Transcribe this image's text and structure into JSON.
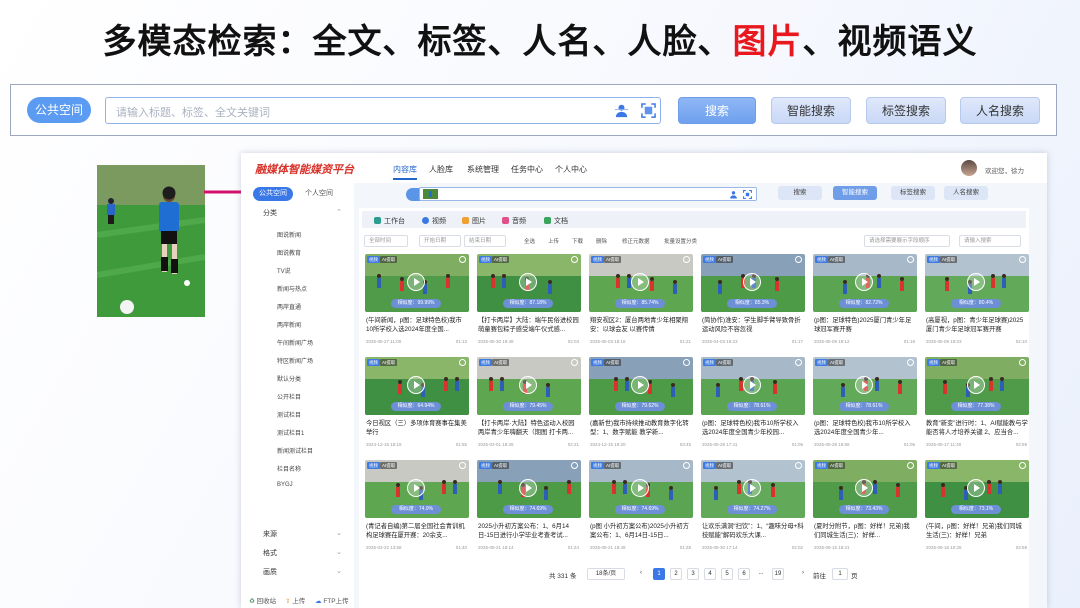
{
  "title": {
    "part1": "多模态检索：全文、标签、人名、人脸、",
    "highlight": "图片",
    "part2": "、视频语义"
  },
  "colors": {
    "accent": "#5b9cf2",
    "highlight": "#e8181e",
    "brand": "#d9322b"
  },
  "big_search": {
    "scope_label": "公共空间",
    "placeholder": "请输入标题、标签、全文关键词",
    "icons": [
      "face-search-icon",
      "image-search-icon"
    ],
    "buttons": [
      "搜索",
      "智能搜索",
      "标签搜索",
      "人名搜索"
    ]
  },
  "app": {
    "brand": "融媒体智能媒资平台",
    "nav": [
      "内容库",
      "人脸库",
      "系统管理",
      "任务中心",
      "个人中心"
    ],
    "user": "欢迎您，徐力",
    "sidebar_tabs": [
      "公共空间",
      "个人空间"
    ],
    "sidebar_sections": [
      {
        "label": "分类",
        "items": [
          "图说新闻",
          "图说教育",
          "TV说",
          "新闻与热点",
          "两岸直通",
          "两岸新闻",
          "午间新闻广场",
          "特区新闻广场",
          "默认分类",
          "公开栏目",
          "测试栏目",
          "测试栏目1",
          "新闻测试栏目",
          "栏目名称",
          "BYGJ"
        ]
      },
      {
        "label": "来源",
        "items": []
      },
      {
        "label": "格式",
        "items": []
      },
      {
        "label": "画质",
        "items": []
      }
    ],
    "sidebar_footer": [
      "回收站",
      "上传",
      "FTP上传"
    ],
    "search_buttons": [
      "搜索",
      "智能搜索",
      "标签搜索",
      "人名搜索"
    ],
    "media_tabs": [
      "工作台",
      "视频",
      "图片",
      "音频",
      "文档"
    ],
    "filters": {
      "time": "全部时间",
      "start": "开始日期",
      "end": "结束日期",
      "select_all": "全选",
      "actions": [
        "上传",
        "下载",
        "删除",
        "修正元数据",
        "批量设置分类"
      ],
      "select_placeholder": "请选择需要展示字段顺序",
      "search_placeholder": "请输入搜索"
    },
    "cards": [
      {
        "title": "(午间新闻，p图：足球特色校)我市10所学校入选2024年度全国...",
        "date": "2025-05-27 11:00",
        "dur": "01:13",
        "sim": "相似度：99.99%",
        "tags": [
          "视频",
          "AI提取"
        ]
      },
      {
        "title": "【打卡两岸】大陆：端午民俗进校园 萌童赛包粽子感受端午仪式感...",
        "date": "2025-05-30 19:48",
        "dur": "02:03",
        "sim": "相似度：87.18%",
        "tags": [
          "视频",
          "AI提取"
        ]
      },
      {
        "title": "翔安视区2：厦台两地青少年相聚翔安：以球会友 以赛传情",
        "date": "2025-05-03 18:16",
        "dur": "01:21",
        "sim": "相似度：85.74%",
        "tags": [
          "视频",
          "AI提取"
        ]
      },
      {
        "title": "(简协作)淮安：学生脚手臂导致骨折 运动风险不容忽视",
        "date": "2025-04-03 19:23",
        "dur": "01:17",
        "sim": "相似度：85.3%",
        "tags": [
          "视频",
          "AI提取"
        ]
      },
      {
        "title": "(p图：足球特色)2025厦门青少年足球冠军赛开赛",
        "date": "2025-05-09 18:12",
        "dur": "01:18",
        "sim": "相似度：82.72%",
        "tags": [
          "视频",
          "AI提取"
        ]
      },
      {
        "title": "(高厦视，p图：青少年足球赛)2025厦门青少年足球冠军赛开赛",
        "date": "2025-05-09 18:03",
        "dur": "02:10",
        "sim": "相似度：80.4%",
        "tags": [
          "视频",
          "AI提取"
        ]
      },
      {
        "title": "今日视区（三）多项体育赛事在集美举行",
        "date": "2024-12-16 18:18",
        "dur": "01:55",
        "sim": "相似度：64.94%",
        "tags": [
          "视频",
          "AI提取"
        ]
      },
      {
        "title": "【打卡两岸·大陆】特色运动入校园 两岸青少年嗨翻天（期图 打卡两...",
        "date": "2025-03-01 18:26",
        "dur": "02:21",
        "sim": "相似度：79.45%",
        "tags": [
          "视频",
          "AI提取"
        ]
      },
      {
        "title": "(嘉新世)我市持续推动教育数字化转型：1、数字赋能 教学新...",
        "date": "2024-12-15 19:20",
        "dur": "03:45",
        "sim": "相似度：79.62%",
        "tags": [
          "视频",
          "AI提取"
        ]
      },
      {
        "title": "(p图：足球特色校)我市10所学校入选2024年度全国青少年校园...",
        "date": "2025-05-28 17:41",
        "dur": "01:05",
        "sim": "相似度：78.61%",
        "tags": [
          "视频",
          "AI提取"
        ]
      },
      {
        "title": "(p图：足球特色校)我市10所学校入选2024年度全国青少年...",
        "date": "2025-05-28 18:58",
        "dur": "01:05",
        "sim": "相似度：78.61%",
        "tags": [
          "视频",
          "AI提取"
        ]
      },
      {
        "title": "教育“新变”进行时：1、AI赋能教与学 能否将人才培养关键 2、应当合...",
        "date": "2025-05-17 11:40",
        "dur": "02:59",
        "sim": "相似度：77.38%",
        "tags": [
          "视频",
          "AI提取"
        ]
      },
      {
        "title": "(青记者自编)第二届全国社会青训机构足球赛在厦开赛：20余支...",
        "date": "2025-03-22 13:58",
        "dur": "01:40",
        "sim": "相似度：74.9%",
        "tags": [
          "视频",
          "AI提取"
        ]
      },
      {
        "title": "2025小升初方案公布：1、6月14日-15日进行小学毕业考查考试...",
        "date": "2025-05-21 18:14",
        "dur": "01:24",
        "sim": "相似度：74.69%",
        "tags": [
          "视频",
          "AI提取"
        ]
      },
      {
        "title": "(p图 小升初方案公布)2025小升初方案公布：1、6月14日-15日...",
        "date": "2025-05-21 18:49",
        "dur": "01:28",
        "sim": "相似度：74.69%",
        "tags": [
          "视频",
          "AI提取"
        ]
      },
      {
        "title": "让欢乐满洞“扫饮”：1、“趣味分母+科技赋能”解码欢乐大课...",
        "date": "2025-05-30 17:14",
        "dur": "02:02",
        "sim": "相似度：74.27%",
        "tags": [
          "视频",
          "AI提取"
        ]
      },
      {
        "title": "(夏时分附节，p图：好样！兄弟)我们同城生活(三)：好样...",
        "date": "2025-06-15 18:21",
        "dur": "",
        "sim": "相似度：73.43%",
        "tags": [
          "视频",
          "AI提取"
        ]
      },
      {
        "title": "(午间，p图：好样！兄弟)我们同城生活(三)：好样！兄弟",
        "date": "2025-06-16 10:26",
        "dur": "02:59",
        "sim": "相似度：73.1%",
        "tags": [
          "视频",
          "AI提取"
        ]
      }
    ],
    "pager": {
      "total": "共 331 条",
      "size": "18条/页",
      "pages": [
        "1",
        "2",
        "3",
        "4",
        "5",
        "6",
        "...",
        "19"
      ],
      "current": "1",
      "goto_label": "前往",
      "goto_value": "1",
      "unit": "页"
    }
  }
}
